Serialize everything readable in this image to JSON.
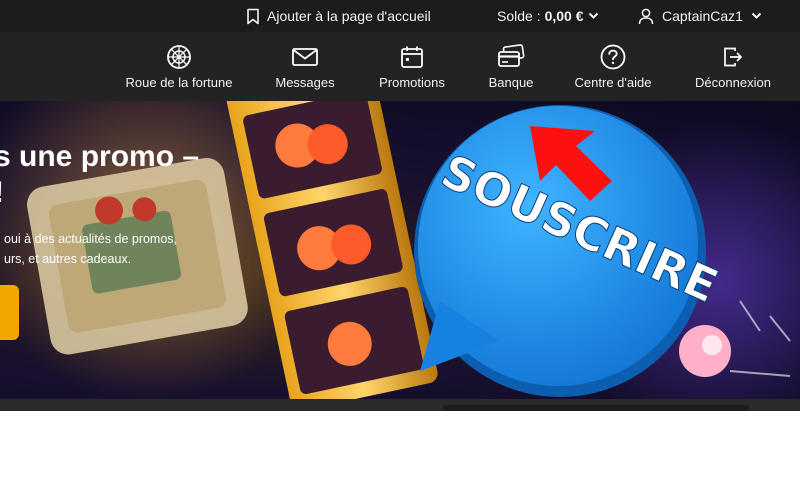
{
  "topbar": {
    "home_link": "Ajouter à la page d'accueil",
    "balance_label": "Solde :",
    "balance_value": "0,00 €",
    "username": "CaptainCaz1"
  },
  "nav": {
    "items": [
      {
        "label": "Roue de la fortune",
        "icon": "wheel-icon"
      },
      {
        "label": "Messages",
        "icon": "envelope-icon"
      },
      {
        "label": "Promotions",
        "icon": "calendar-icon"
      },
      {
        "label": "Banque",
        "icon": "cards-icon"
      },
      {
        "label": "Centre d'aide",
        "icon": "help-icon"
      },
      {
        "label": "Déconnexion",
        "icon": "logout-icon"
      }
    ]
  },
  "hero": {
    "title_line1": "s une promo –",
    "title_line2": "!",
    "text_line1": "oui à des actualités de promos,",
    "text_line2": "urs, et autres cadeaux.",
    "bubble_text": "SOUSCRIRE",
    "colors": {
      "bubble": "#1a8fe8",
      "arrow": "#ff1010",
      "cta": "#f3a600"
    }
  }
}
